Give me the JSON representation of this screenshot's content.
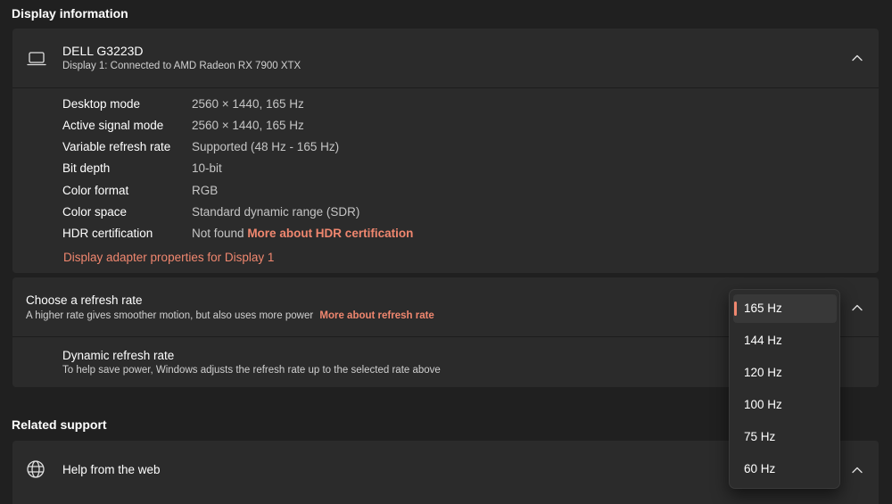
{
  "display_info": {
    "section_title": "Display information",
    "device_name": "DELL G3223D",
    "device_subtitle": "Display 1: Connected to AMD Radeon RX 7900 XTX",
    "rows": [
      {
        "label": "Desktop mode",
        "value": "2560 × 1440, 165 Hz"
      },
      {
        "label": "Active signal mode",
        "value": "2560 × 1440, 165 Hz"
      },
      {
        "label": "Variable refresh rate",
        "value": "Supported (48 Hz - 165 Hz)"
      },
      {
        "label": "Bit depth",
        "value": "10-bit"
      },
      {
        "label": "Color format",
        "value": "RGB"
      },
      {
        "label": "Color space",
        "value": "Standard dynamic range (SDR)"
      },
      {
        "label": "HDR certification",
        "value": "Not found",
        "link": "More about HDR certification"
      }
    ],
    "adapter_link": "Display adapter properties for Display 1"
  },
  "refresh_rate": {
    "title": "Choose a refresh rate",
    "subtitle": "A higher rate gives smoother motion, but also uses more power",
    "link": "More about refresh rate",
    "dynamic_title": "Dynamic refresh rate",
    "dynamic_subtitle": "To help save power, Windows adjusts the refresh rate up to the selected rate above",
    "options": [
      "165 Hz",
      "144 Hz",
      "120 Hz",
      "100 Hz",
      "75 Hz",
      "60 Hz"
    ],
    "selected": "165 Hz"
  },
  "related_support": {
    "section_title": "Related support",
    "help_label": "Help from the web"
  },
  "icons": {
    "monitor": "laptop-icon",
    "globe": "globe-icon",
    "chevron": "chevron-up-icon"
  },
  "colors": {
    "accent": "#f0876f",
    "background": "#202020",
    "card": "#2b2b2b"
  }
}
